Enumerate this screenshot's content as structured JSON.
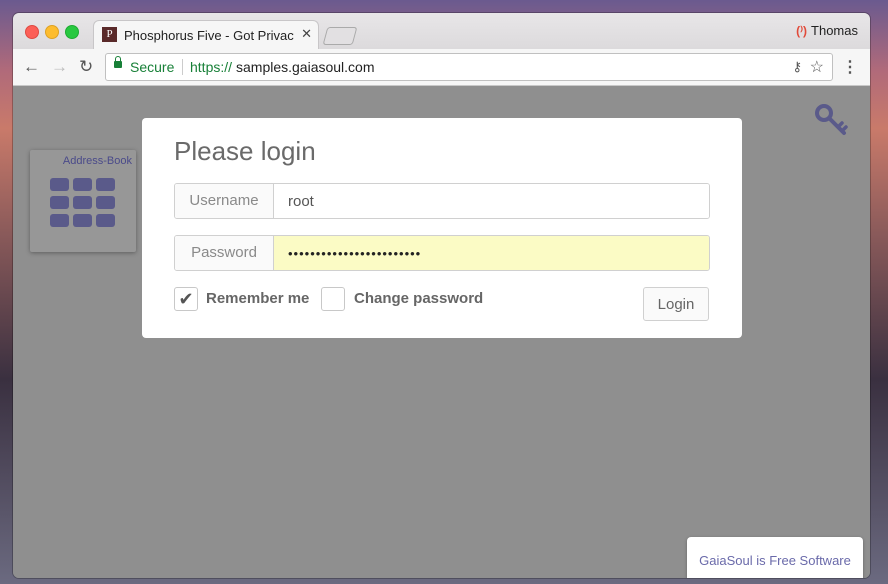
{
  "browser": {
    "tab": {
      "favicon_text": "P",
      "title": "Phosphorus Five - Got Privacy?",
      "close_glyph": "✕"
    },
    "profile": {
      "name": "Thomas",
      "icon": "profile-switch-icon",
      "icon_glyph": "(⁾)"
    },
    "nav": {
      "back_glyph": "←",
      "forward_glyph": "→",
      "reload_glyph": "↻"
    },
    "omnibox": {
      "secure_label": "Secure",
      "url_scheme": "https://",
      "url_host": "samples.gaiasoul.com"
    },
    "key_glyph": "⚷",
    "star_glyph": "☆",
    "menu_glyph": "⋮"
  },
  "page": {
    "app_tile": {
      "label": "Address-Book"
    },
    "login": {
      "title": "Please login",
      "username_label": "Username",
      "username_value": "root",
      "password_label": "Password",
      "password_value": "••••••••••••••••••••••••",
      "remember_label": "Remember me",
      "remember_checked": true,
      "remember_glyph": "✔",
      "change_password_label": "Change password",
      "change_password_checked": false,
      "login_button": "Login"
    },
    "footer_badge": "GaiaSoul is Free Software"
  },
  "colors": {
    "accent": "#5a5a8a",
    "secure_green": "#188038",
    "password_autofill": "#fbfbc5"
  }
}
